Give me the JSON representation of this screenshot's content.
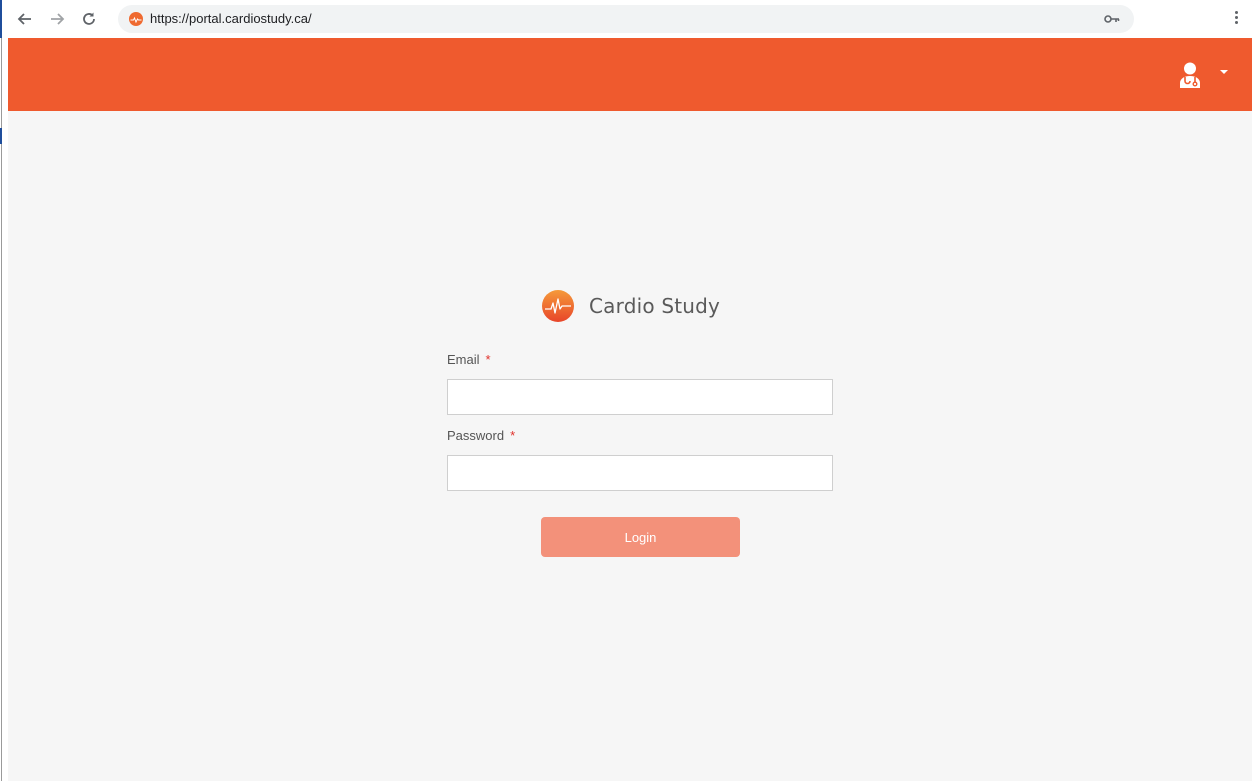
{
  "browser": {
    "url": "https://portal.cardiostudy.ca/",
    "back_icon": "arrow-left-icon",
    "forward_icon": "arrow-right-icon",
    "reload_icon": "reload-icon",
    "key_icon": "key-icon",
    "menu_icon": "kebab-menu-icon"
  },
  "header": {
    "background_color": "#ef5a2e",
    "user_icon": "doctor-avatar-icon"
  },
  "brand": {
    "name": "Cardio Study",
    "logo_icon": "heartbeat-logo-icon"
  },
  "form": {
    "email_label": "Email",
    "email_required": "*",
    "email_value": "",
    "password_label": "Password",
    "password_required": "*",
    "password_value": "",
    "login_label": "Login",
    "button_color": "#f3917a"
  }
}
